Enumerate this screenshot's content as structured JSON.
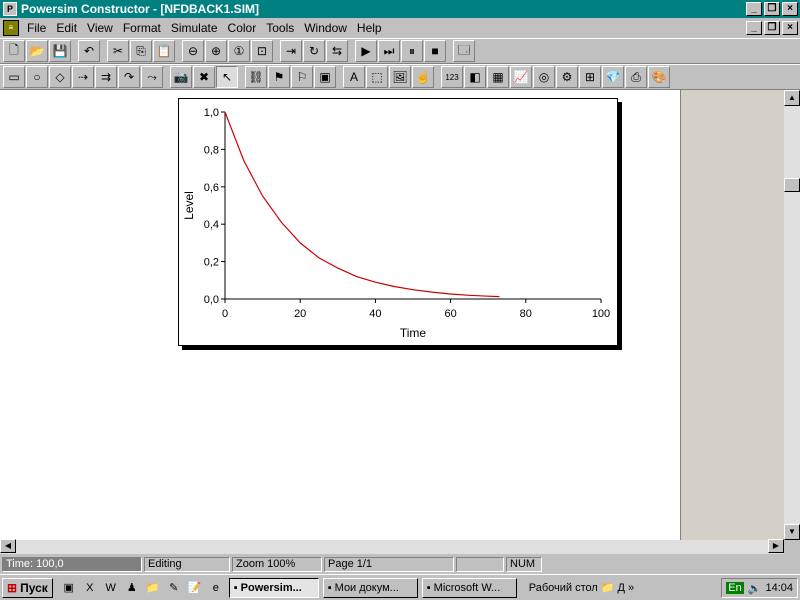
{
  "window": {
    "title": "Powersim Constructor - [NFDBACK1.SIM]",
    "minimize": "_",
    "restore": "❐",
    "close": "×",
    "mdi_minimize": "_",
    "mdi_restore": "❐",
    "mdi_close": "×"
  },
  "menu": [
    {
      "label": "File"
    },
    {
      "label": "Edit"
    },
    {
      "label": "View"
    },
    {
      "label": "Format"
    },
    {
      "label": "Simulate"
    },
    {
      "label": "Color"
    },
    {
      "label": "Tools"
    },
    {
      "label": "Window"
    },
    {
      "label": "Help"
    }
  ],
  "toolbar1": [
    {
      "name": "new-icon",
      "glyph": "🗋"
    },
    {
      "name": "open-icon",
      "glyph": "📂"
    },
    {
      "name": "save-icon",
      "glyph": "💾"
    },
    {
      "name": "sep"
    },
    {
      "name": "undo-icon",
      "glyph": "↶"
    },
    {
      "name": "sep"
    },
    {
      "name": "cut-icon",
      "glyph": "✂"
    },
    {
      "name": "copy-icon",
      "glyph": "⎘"
    },
    {
      "name": "paste-icon",
      "glyph": "📋"
    },
    {
      "name": "sep"
    },
    {
      "name": "zoom-out-icon",
      "glyph": "⊖"
    },
    {
      "name": "zoom-in-icon",
      "glyph": "⊕"
    },
    {
      "name": "zoom-normal-icon",
      "glyph": "①"
    },
    {
      "name": "zoom-fit-icon",
      "glyph": "⊡"
    },
    {
      "name": "sep"
    },
    {
      "name": "link-icon",
      "glyph": "⇥"
    },
    {
      "name": "rotate-icon",
      "glyph": "↻"
    },
    {
      "name": "layout-icon",
      "glyph": "⇆"
    },
    {
      "name": "sep"
    },
    {
      "name": "run-icon",
      "glyph": "▶"
    },
    {
      "name": "step-icon",
      "glyph": "⏭"
    },
    {
      "name": "pause-icon",
      "glyph": "⏸"
    },
    {
      "name": "stop-icon",
      "glyph": "■"
    },
    {
      "name": "sep"
    },
    {
      "name": "properties-icon",
      "glyph": "🗔"
    }
  ],
  "toolbar2": [
    {
      "name": "level-icon",
      "glyph": "▭"
    },
    {
      "name": "auxiliary-icon",
      "glyph": "○"
    },
    {
      "name": "constant-icon",
      "glyph": "◇"
    },
    {
      "name": "flow-icon",
      "glyph": "⇢"
    },
    {
      "name": "flow-with-rate-icon",
      "glyph": "⇉"
    },
    {
      "name": "link-arc-icon",
      "glyph": "↷"
    },
    {
      "name": "delayed-link-icon",
      "glyph": "⤳"
    },
    {
      "name": "sep"
    },
    {
      "name": "snapshot-icon",
      "glyph": "📷"
    },
    {
      "name": "delete-icon",
      "glyph": "✖"
    },
    {
      "name": "pointer-icon",
      "glyph": "↖",
      "pressed": true
    },
    {
      "name": "sep"
    },
    {
      "name": "chain-icon",
      "glyph": "⛓"
    },
    {
      "name": "flag-link-icon",
      "glyph": "⚑"
    },
    {
      "name": "flag-link2-icon",
      "glyph": "⚐"
    },
    {
      "name": "group-icon",
      "glyph": "▣"
    },
    {
      "name": "sep"
    },
    {
      "name": "text-icon",
      "glyph": "A"
    },
    {
      "name": "frame-icon",
      "glyph": "⬚"
    },
    {
      "name": "picture-icon",
      "glyph": "🖼"
    },
    {
      "name": "button-icon",
      "glyph": "☝"
    },
    {
      "name": "sep"
    },
    {
      "name": "number-icon",
      "glyph": "123"
    },
    {
      "name": "slider-icon",
      "glyph": "◧"
    },
    {
      "name": "table-icon",
      "glyph": "▦"
    },
    {
      "name": "graph-icon",
      "glyph": "📈"
    },
    {
      "name": "scatter-icon",
      "glyph": "◎"
    },
    {
      "name": "gauge-icon",
      "glyph": "⚙"
    },
    {
      "name": "bar-icon",
      "glyph": "⊞"
    },
    {
      "name": "diamond-icon",
      "glyph": "💎"
    },
    {
      "name": "print-icon",
      "glyph": "⎙"
    },
    {
      "name": "palette-icon",
      "glyph": "🎨"
    }
  ],
  "status": {
    "time": "Time: 100,0",
    "mode": "Editing",
    "zoom": "Zoom 100%",
    "page": "Page  1/1",
    "blank": "",
    "num": "NUM"
  },
  "taskbar": {
    "start": "Пуск",
    "quick": [
      {
        "name": "desktop-icon",
        "glyph": "▣"
      },
      {
        "name": "excel-icon",
        "glyph": "X"
      },
      {
        "name": "word-icon",
        "glyph": "W"
      },
      {
        "name": "office-icon",
        "glyph": "♟"
      },
      {
        "name": "folder-tool-icon",
        "glyph": "📁"
      },
      {
        "name": "pencil-icon",
        "glyph": "✎"
      },
      {
        "name": "notes-icon",
        "glyph": "📝"
      },
      {
        "name": "ie-icon",
        "glyph": "e"
      }
    ],
    "tasks": [
      {
        "label": "Powersim...",
        "active": true,
        "name": "task-powersim"
      },
      {
        "label": "Мои докум...",
        "active": false,
        "name": "task-my-documents"
      },
      {
        "label": "Microsoft W...",
        "active": false,
        "name": "task-microsoft-word"
      }
    ],
    "desktop_label": "Рабочий стол",
    "desktop_folder": "Д",
    "more": "»",
    "lang": "En",
    "clock": "14:04"
  },
  "chart_data": {
    "type": "line",
    "xlabel": "Time",
    "ylabel": "Level",
    "xlim": [
      0,
      100
    ],
    "ylim": [
      0,
      1
    ],
    "xticks": [
      "0",
      "20",
      "40",
      "60",
      "80",
      "100"
    ],
    "yticks": [
      "0,0",
      "0,2",
      "0,4",
      "0,6",
      "0,8",
      "1,0"
    ],
    "series": [
      {
        "color": "#cc0000",
        "x": [
          0,
          5,
          10,
          15,
          20,
          25,
          30,
          35,
          40,
          45,
          50,
          55,
          60,
          65,
          70,
          73
        ],
        "y": [
          1.0,
          0.74,
          0.55,
          0.41,
          0.3,
          0.22,
          0.165,
          0.12,
          0.09,
          0.067,
          0.05,
          0.037,
          0.027,
          0.02,
          0.015,
          0.013
        ]
      }
    ]
  }
}
